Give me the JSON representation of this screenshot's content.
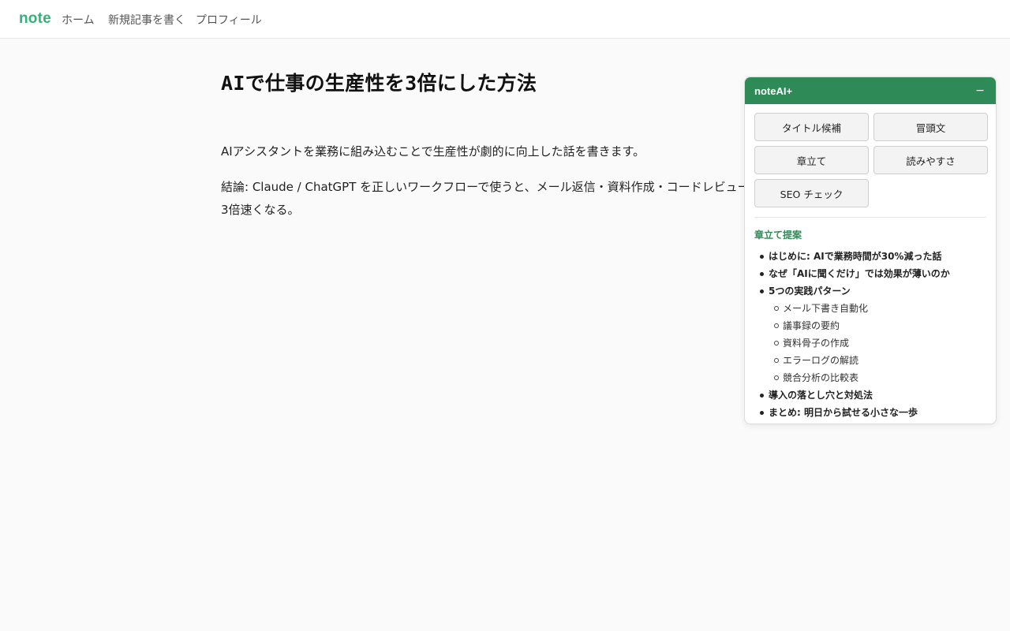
{
  "header": {
    "logo": "note",
    "nav": {
      "home": "ホーム",
      "new_article": "新規記事を書く",
      "profile": "プロフィール"
    }
  },
  "article": {
    "title": "AIで仕事の生産性を3倍にした方法",
    "paragraphs": [
      "AIアシスタントを業務に組み込むことで生産性が劇的に向上した話を書きます。",
      "結論: Claude / ChatGPT を正しいワークフローで使うと、メール返信・資料作成・コードレビュー",
      "3倍速くなる。"
    ]
  },
  "panel": {
    "title": "noteAI+",
    "minimize": "−",
    "buttons": {
      "title_candidates": "タイトル候補",
      "intro": "冒頭文",
      "chapters": "章立て",
      "readability": "読みやすさ",
      "seo_check": "SEO チェック"
    },
    "section_title": "章立て提案",
    "outline": {
      "item1": "はじめに: AIで業務時間が30%減った話",
      "item2": "なぜ「AIに聞くだけ」では効果が薄いのか",
      "item3": "5つの実践パターン",
      "sub": [
        "メール下書き自動化",
        "議事録の要約",
        "資料骨子の作成",
        "エラーログの解読",
        "競合分析の比較表"
      ],
      "item4": "導入の落とし穴と対処法",
      "item5": "まとめ: 明日から試せる小さな一歩"
    }
  },
  "colors": {
    "brand": "#2fb47c",
    "panel_header": "#2e8b57"
  }
}
